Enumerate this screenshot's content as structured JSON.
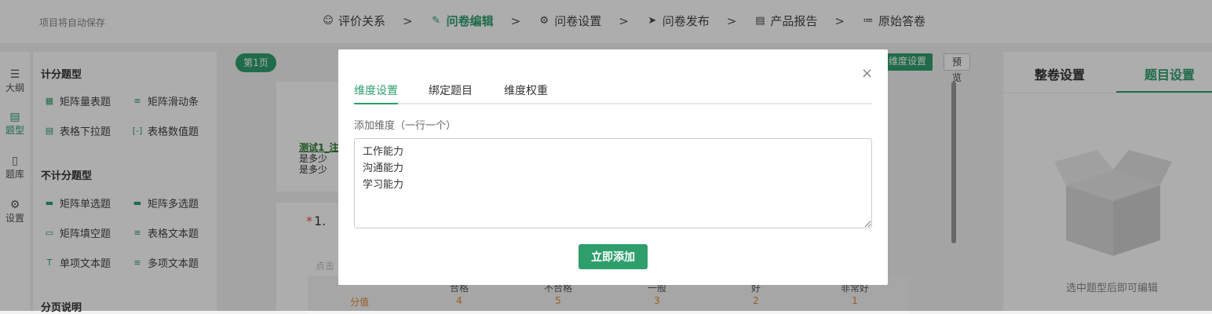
{
  "header": {
    "autosave": "项目将自动保存",
    "steps": [
      {
        "label": "评价关系",
        "icon": "users-icon"
      },
      {
        "label": "问卷编辑",
        "icon": "pencil-icon"
      },
      {
        "label": "问卷设置",
        "icon": "gear-icon"
      },
      {
        "label": "问卷发布",
        "icon": "send-icon"
      },
      {
        "label": "产品报告",
        "icon": "clipboard-icon"
      },
      {
        "label": "原始答卷",
        "icon": "chart-icon"
      }
    ],
    "separator": ">"
  },
  "leftrail": {
    "items": [
      {
        "label": "大纲",
        "icon": "sliders-icon"
      },
      {
        "label": "题型",
        "icon": "doc-icon"
      },
      {
        "label": "题库",
        "icon": "book-icon"
      },
      {
        "label": "设置",
        "icon": "gear-icon"
      }
    ]
  },
  "palette": {
    "scored_title": "计分题型",
    "scored": [
      "矩阵量表题",
      "矩阵滑动条",
      "表格下拉题",
      "表格数值题"
    ],
    "unscored_title": "不计分题型",
    "unscored": [
      "矩阵单选题",
      "矩阵多选题",
      "矩阵填空题",
      "表格文本题",
      "单项文本题",
      "多项文本题"
    ],
    "section_title": "分页说明"
  },
  "canvas": {
    "page_pill": "第1页",
    "dimension_button": "维度设置",
    "preview_button": "预 览",
    "test_link": "测试1_注",
    "test_line2": "是多少",
    "test_line3": "是多少",
    "question_number": "1.",
    "question_required": "*",
    "hint": "点击",
    "matrix_headers": [
      "合格",
      "不合格",
      "一般",
      "好",
      "非常好"
    ],
    "matrix_row_label": "分值",
    "matrix_values": [
      "4",
      "5",
      "3",
      "2",
      "1"
    ]
  },
  "rightpanel": {
    "tab_whole": "整卷设置",
    "tab_question": "题目设置",
    "empty_text": "选中题型后即可编辑"
  },
  "modal": {
    "tabs": [
      "维度设置",
      "绑定题目",
      "维度权重"
    ],
    "field_label": "添加维度（一行一个）",
    "textarea_value": "工作能力\n沟通能力\n学习能力",
    "submit": "立即添加",
    "close": "×"
  },
  "colors": {
    "accent": "#2e9e6d",
    "value": "#e08a2e"
  }
}
